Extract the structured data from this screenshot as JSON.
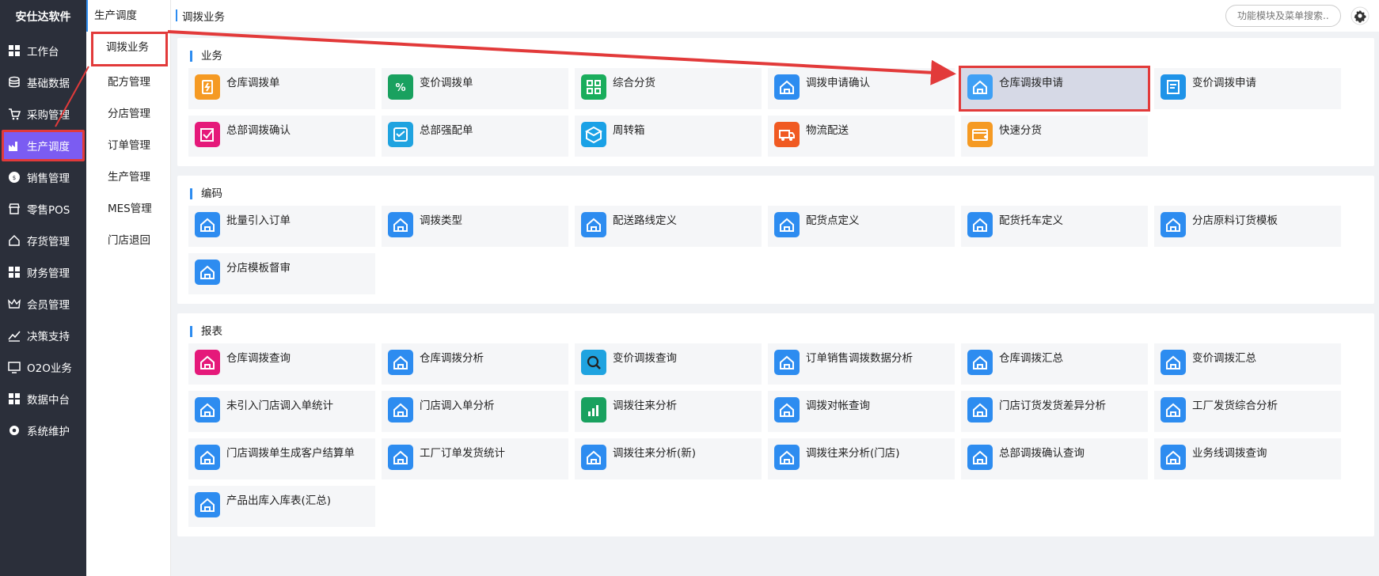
{
  "brand": "安仕达软件",
  "nav": [
    {
      "label": "工作台",
      "icon": "grid-icon"
    },
    {
      "label": "基础数据",
      "icon": "database-icon"
    },
    {
      "label": "采购管理",
      "icon": "cart-icon"
    },
    {
      "label": "生产调度",
      "icon": "factory-icon",
      "active": true
    },
    {
      "label": "销售管理",
      "icon": "sales-icon"
    },
    {
      "label": "零售POS",
      "icon": "store-icon"
    },
    {
      "label": "存货管理",
      "icon": "home-icon"
    },
    {
      "label": "财务管理",
      "icon": "grid-icon"
    },
    {
      "label": "会员管理",
      "icon": "crown-icon"
    },
    {
      "label": "决策支持",
      "icon": "chart-icon"
    },
    {
      "label": "O2O业务",
      "icon": "monitor-icon"
    },
    {
      "label": "数据中台",
      "icon": "grid-icon"
    },
    {
      "label": "系统维护",
      "icon": "gear-icon"
    }
  ],
  "submenu": {
    "title": "生产调度",
    "items": [
      "调拨业务",
      "配方管理",
      "分店管理",
      "订单管理",
      "生产管理",
      "MES管理",
      "门店退回"
    ]
  },
  "breadcrumb": "调拨业务",
  "search": {
    "placeholder": "功能模块及菜单搜索..."
  },
  "colors": {
    "accent": "#2d8cf0",
    "sidebar": "#2b2f3a",
    "active_nav": "#7b5cf2",
    "highlight_border": "#e23a3a"
  },
  "sections": [
    {
      "title": "业务",
      "cards": [
        {
          "label": "仓库调拨单",
          "icon": "orange-doc-icon",
          "color": "#f59a23"
        },
        {
          "label": "变价调拨单",
          "icon": "green-percent-icon",
          "color": "#19a15f"
        },
        {
          "label": "综合分货",
          "icon": "green-apps-icon",
          "color": "#1aad5c"
        },
        {
          "label": "调拨申请确认",
          "icon": "house-icon",
          "color": "#2d8cf0"
        },
        {
          "label": "仓库调拨申请",
          "icon": "house-icon",
          "color": "#3ea0f5",
          "highlight": true
        },
        {
          "label": "变价调拨申请",
          "icon": "doc-blue-icon",
          "color": "#1f93e8"
        },
        {
          "label": "总部调拨确认",
          "icon": "pink-check-icon",
          "color": "#e5197a"
        },
        {
          "label": "总部强配单",
          "icon": "blue-list-icon",
          "color": "#1fa3e0"
        },
        {
          "label": "周转箱",
          "icon": "box-icon",
          "color": "#1aa1e6"
        },
        {
          "label": "物流配送",
          "icon": "truck-icon",
          "color": "#f05a22"
        },
        {
          "label": "快速分货",
          "icon": "orange-card-icon",
          "color": "#f59a23"
        }
      ]
    },
    {
      "title": "编码",
      "cards": [
        {
          "label": "批量引入订单",
          "icon": "house-icon",
          "color": "#2d8cf0"
        },
        {
          "label": "调拨类型",
          "icon": "house-icon",
          "color": "#2d8cf0"
        },
        {
          "label": "配送路线定义",
          "icon": "house-icon",
          "color": "#2d8cf0"
        },
        {
          "label": "配货点定义",
          "icon": "house-icon",
          "color": "#2d8cf0"
        },
        {
          "label": "配货托车定义",
          "icon": "house-icon",
          "color": "#2d8cf0"
        },
        {
          "label": "分店原料订货模板",
          "icon": "house-icon",
          "color": "#2d8cf0"
        },
        {
          "label": "分店模板督审",
          "icon": "house-icon",
          "color": "#2d8cf0"
        }
      ]
    },
    {
      "title": "报表",
      "cards": [
        {
          "label": "仓库调拨查询",
          "icon": "pink-house-icon",
          "color": "#e5197a"
        },
        {
          "label": "仓库调拨分析",
          "icon": "house-icon",
          "color": "#2d8cf0"
        },
        {
          "label": "变价调拨查询",
          "icon": "magnifier-icon",
          "color": "#1fa3e0"
        },
        {
          "label": "订单销售调拨数据分析",
          "icon": "house-icon",
          "color": "#2d8cf0"
        },
        {
          "label": "仓库调拨汇总",
          "icon": "house-icon",
          "color": "#2d8cf0"
        },
        {
          "label": "变价调拨汇总",
          "icon": "house-icon",
          "color": "#2d8cf0"
        },
        {
          "label": "未引入门店调入单统计",
          "icon": "house-icon",
          "color": "#2d8cf0"
        },
        {
          "label": "门店调入单分析",
          "icon": "house-icon",
          "color": "#2d8cf0"
        },
        {
          "label": "调拨往来分析",
          "icon": "bar-chart-icon",
          "color": "#19a15f"
        },
        {
          "label": "调拨对帐查询",
          "icon": "house-icon",
          "color": "#2d8cf0"
        },
        {
          "label": "门店订货发货差异分析",
          "icon": "house-icon",
          "color": "#2d8cf0"
        },
        {
          "label": "工厂发货综合分析",
          "icon": "house-icon",
          "color": "#2d8cf0"
        },
        {
          "label": "门店调拨单生成客户结算单",
          "icon": "house-icon",
          "color": "#2d8cf0"
        },
        {
          "label": "工厂订单发货统计",
          "icon": "house-icon",
          "color": "#2d8cf0"
        },
        {
          "label": "调拨往来分析(新)",
          "icon": "house-icon",
          "color": "#2d8cf0"
        },
        {
          "label": "调拨往来分析(门店)",
          "icon": "house-icon",
          "color": "#2d8cf0"
        },
        {
          "label": "总部调拨确认查询",
          "icon": "house-icon",
          "color": "#2d8cf0"
        },
        {
          "label": "业务线调拨查询",
          "icon": "house-icon",
          "color": "#2d8cf0"
        },
        {
          "label": "产品出库入库表(汇总)",
          "icon": "house-icon",
          "color": "#2d8cf0"
        }
      ]
    }
  ]
}
